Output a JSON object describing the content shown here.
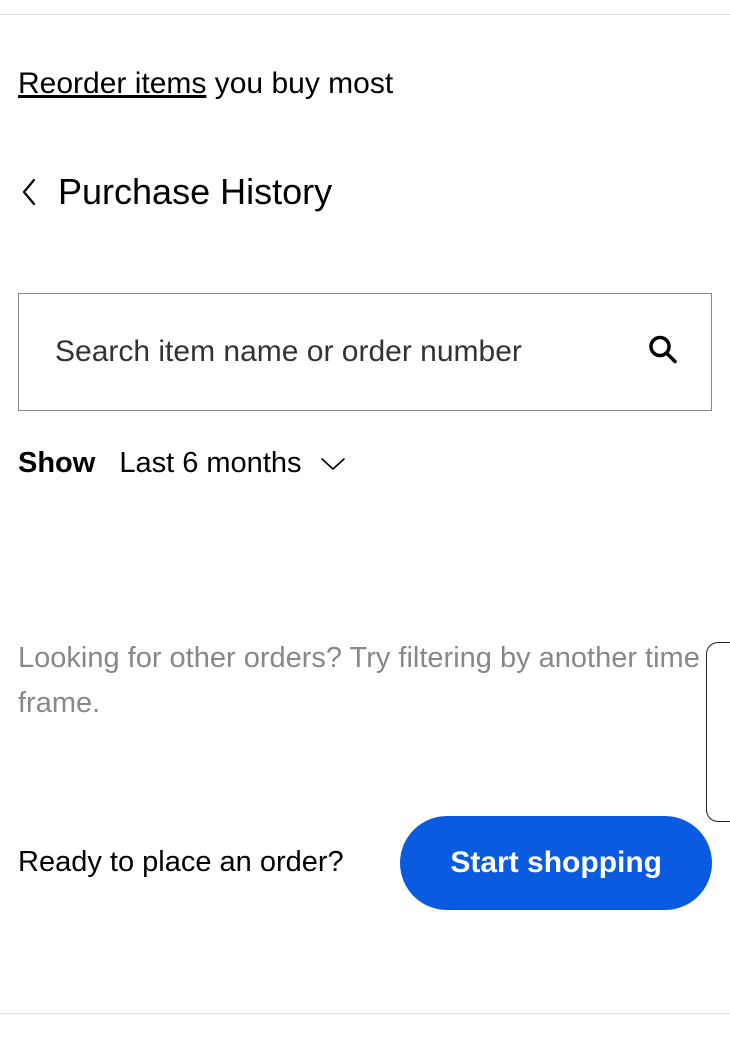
{
  "reorder": {
    "link_text": "Reorder items",
    "suffix_text": " you buy most"
  },
  "header": {
    "title": "Purchase History"
  },
  "search": {
    "placeholder": "Search item name or order number"
  },
  "filter": {
    "label": "Show",
    "selected": "Last 6 months"
  },
  "empty_state": {
    "message": "Looking for other orders? Try filtering by another time frame."
  },
  "cta": {
    "prompt": "Ready to place an order?",
    "button_label": "Start shopping"
  },
  "colors": {
    "accent": "#0a5be0"
  }
}
